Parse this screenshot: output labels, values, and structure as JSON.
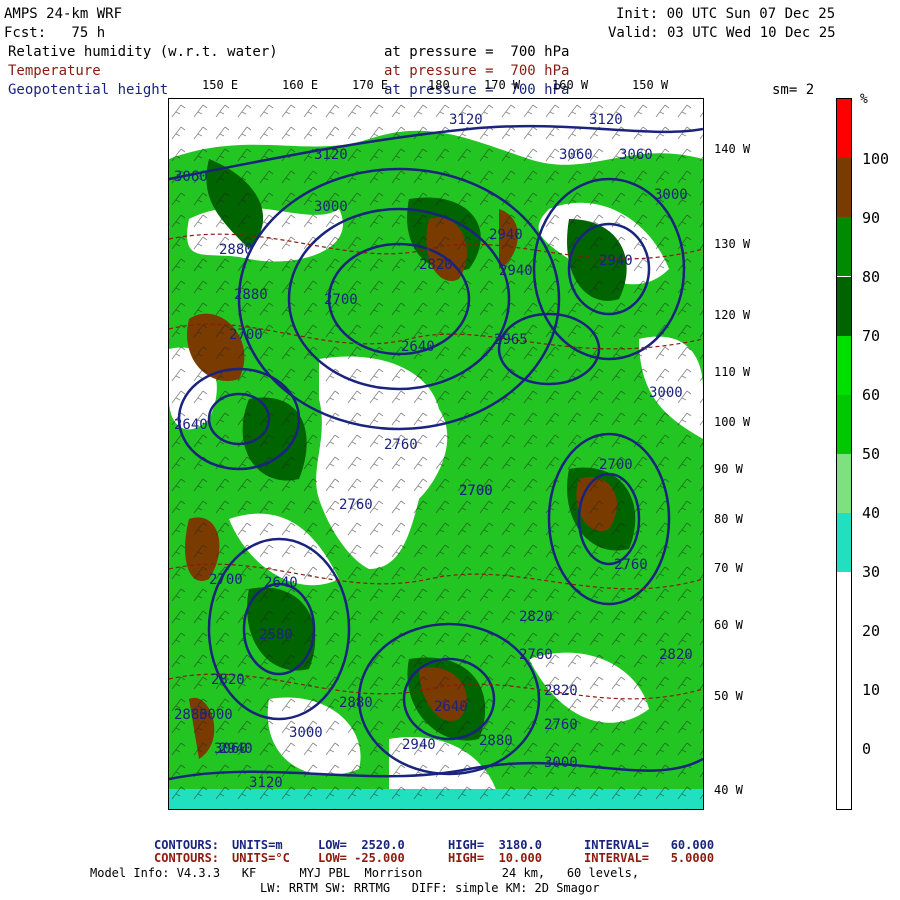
{
  "header": {
    "model_title": "AMPS 24-km WRF",
    "forecast": "Fcst:   75 h",
    "init": "Init: 00 UTC Sun 07 Dec 25",
    "valid": "Valid: 03 UTC Wed 10 Dec 25",
    "smoothing": "sm= 2"
  },
  "fields": [
    {
      "name": "Relative humidity (w.r.t. water)",
      "level": "at pressure =  700 hPa",
      "color": "#000000"
    },
    {
      "name": "Temperature",
      "level": "at pressure =  700 hPa",
      "color": "#8b1a10"
    },
    {
      "name": "Geopotential height",
      "level": "at pressure =  700 hPa",
      "color": "#1a237e"
    }
  ],
  "longitude_labels": [
    "150 E",
    "160 E",
    "170 E",
    "180",
    "170 W",
    "160 W",
    "150 W"
  ],
  "latitude_labels": [
    "140 W",
    "130 W",
    "120 W",
    "110 W",
    "100 W",
    "90 W",
    "80 W",
    "70 W",
    "60 W",
    "50 W",
    "40 W"
  ],
  "contour_labels": [
    "3120",
    "3120",
    "3060",
    "3060",
    "3120",
    "3000",
    "2940",
    "2880",
    "2820",
    "2880",
    "2940",
    "2700",
    "2940",
    "2965",
    "2700",
    "2760",
    "2700",
    "2760",
    "2640",
    "2580",
    "2640",
    "2700",
    "2820",
    "2880",
    "2940",
    "3000",
    "3060",
    "3120",
    "2880",
    "2820",
    "2760",
    "2640",
    "2700",
    "3000",
    "3060",
    "2940",
    "2880",
    "2820",
    "2760",
    "3000",
    "3000",
    "2640",
    "2700",
    "2760",
    "2820",
    "3000"
  ],
  "colorbar": {
    "unit": "%",
    "labels": [
      "100",
      "90",
      "80",
      "70",
      "60",
      "50",
      "40",
      "30",
      "20",
      "10",
      "0"
    ],
    "colors": [
      "#ff0000",
      "#7a3b00",
      "#008a00",
      "#006400",
      "#00e000",
      "#00c800",
      "#7ee07e",
      "#20e0c0",
      "#ffffff",
      "#ffffff",
      "#ffffff",
      "#ffffff"
    ]
  },
  "footer": {
    "height_contours": {
      "label": "CONTOURS:",
      "units": "UNITS=m",
      "low": "LOW=  2520.0",
      "high": "HIGH=  3180.0",
      "interval": "INTERVAL=   60.000",
      "color": "#1a237e"
    },
    "temp_contours": {
      "label": "CONTOURS:",
      "units": "UNITS=°C",
      "low": "LOW= -25.000",
      "high": "HIGH=  10.000",
      "interval": "INTERVAL=   5.0000",
      "color": "#8b1a10"
    },
    "model_info": "Model Info: V4.3.3   KF      MYJ PBL  Morrison           24 km,   60 levels,",
    "physics": "LW: RRTM SW: RRTMG   DIFF: simple KM: 2D Smagor"
  }
}
